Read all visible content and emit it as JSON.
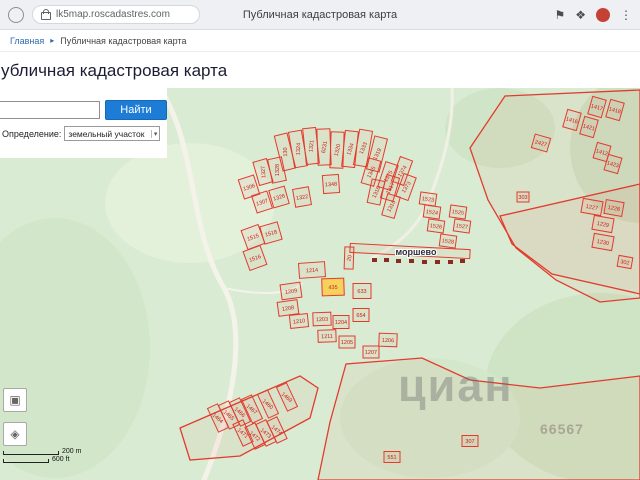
{
  "browser": {
    "url": "lk5map.roscadastres.com",
    "tab_title": "Публичная кадастровая карта"
  },
  "icons": {
    "bookmark": "⚑",
    "extensions": "❖",
    "menu": "⋮",
    "dropdown": "▾",
    "frame": "▣",
    "layers": "◈"
  },
  "breadcrumb": {
    "home": "Главная",
    "separator": "▸",
    "current": "Публичная кадастровая карта"
  },
  "page": {
    "title": "убличная кадастровая карта"
  },
  "search": {
    "button": "Найти",
    "filter_label": "Определение:",
    "filter_value": "земельный участок"
  },
  "map": {
    "place_label": "моршево",
    "watermark": {
      "brand": "циан",
      "number": "66567"
    },
    "scale": {
      "metric": "200 m",
      "imperial": "600 ft"
    },
    "colors": {
      "base": "#d9ecd3",
      "parcel_stroke": "#e23b2e",
      "parcel_fill": "rgba(240,70,50,0.06)",
      "label": "#c81e14",
      "building": "#8a2b20"
    },
    "terrain": [
      [
        600,
        300,
        115,
        95,
        "#cfe4c5"
      ],
      [
        640,
        60,
        70,
        75,
        "#cde2c3"
      ],
      [
        55,
        260,
        95,
        130,
        "#d2e7ca"
      ],
      [
        500,
        40,
        55,
        40,
        "#d0e5c7"
      ],
      [
        190,
        115,
        85,
        60,
        "#e3f0da"
      ],
      [
        430,
        330,
        90,
        60,
        "#d3e7cb"
      ]
    ],
    "roads": [
      [
        "M160,0 C198,60 188,140 224,200 C246,240 236,312 204,392",
        "#f4f3ea",
        5
      ],
      [
        "M452,0 C454,44 440,84 428,114 C418,140 396,158 372,170",
        "#f0f1e4",
        3
      ],
      [
        "M224,200 C262,208 288,206 302,196",
        "#f4f3ea",
        2
      ]
    ],
    "boundaries": [
      "470,60 505,8 640,2 640,210 600,214 556,192 516,160 488,112",
      "500,128 640,96 640,206 552,186 512,156",
      "330,334 346,276 422,270 470,292 540,300 640,288 640,392 318,392",
      "180,340 300,288 318,300 310,330 240,368 190,372"
    ],
    "parcels": [
      [
        "130",
        285,
        64,
        13,
        36,
        -14,
        -78
      ],
      [
        "1324",
        298,
        61,
        13,
        36,
        -10,
        -78
      ],
      [
        "1321",
        311,
        58,
        13,
        36,
        -6,
        -78
      ],
      [
        "6231",
        324,
        59,
        13,
        36,
        -2,
        -78
      ],
      [
        "1320",
        337,
        62,
        13,
        36,
        2,
        -78
      ],
      [
        "1334",
        350,
        61,
        13,
        36,
        6,
        -78
      ],
      [
        "1333",
        363,
        60,
        13,
        36,
        10,
        -78
      ],
      [
        "1319",
        377,
        66,
        13,
        34,
        14,
        -78
      ],
      [
        "1345",
        371,
        84,
        13,
        26,
        16,
        -78
      ],
      [
        "1375",
        388,
        88,
        13,
        26,
        18,
        -78
      ],
      [
        "1374",
        402,
        83,
        13,
        26,
        20,
        -78
      ],
      [
        "1373",
        406,
        99,
        13,
        24,
        20,
        -78
      ],
      [
        "1317",
        390,
        100,
        13,
        24,
        16,
        -78
      ],
      [
        "1318",
        376,
        104,
        13,
        24,
        12,
        -78
      ],
      [
        "1316",
        391,
        118,
        13,
        22,
        16,
        -78
      ],
      [
        "1306",
        249,
        99,
        16,
        20,
        -18,
        0
      ],
      [
        "1327",
        263,
        84,
        14,
        24,
        -16,
        -78
      ],
      [
        "1328",
        277,
        82,
        14,
        24,
        -12,
        -78
      ],
      [
        "1307",
        262,
        114,
        16,
        18,
        -18,
        0
      ],
      [
        "1326",
        279,
        109,
        16,
        18,
        -16,
        0
      ],
      [
        "1322",
        302,
        109,
        16,
        18,
        -10,
        0
      ],
      [
        "1348",
        331,
        96,
        16,
        18,
        -4,
        0
      ],
      [
        "1515",
        253,
        149,
        18,
        20,
        -20,
        0
      ],
      [
        "1518",
        271,
        145,
        18,
        18,
        -16,
        0
      ],
      [
        "1516",
        255,
        170,
        18,
        20,
        -20,
        0
      ],
      [
        "1214",
        312,
        182,
        26,
        15,
        -4,
        0
      ],
      [
        "20",
        349,
        170,
        9,
        22,
        2,
        -78
      ],
      [
        "435",
        333,
        199,
        22,
        17,
        -2,
        0,
        "#f6d15c"
      ],
      [
        "633",
        362,
        203,
        18,
        15,
        0,
        0
      ],
      [
        "1209",
        291,
        203,
        20,
        15,
        -8,
        0
      ],
      [
        "1208",
        288,
        220,
        20,
        14,
        -8,
        0
      ],
      [
        "1210",
        299,
        233,
        18,
        13,
        -6,
        0
      ],
      [
        "1203",
        322,
        231,
        18,
        13,
        -2,
        0
      ],
      [
        "1204",
        341,
        234,
        16,
        13,
        0,
        0
      ],
      [
        "654",
        361,
        227,
        16,
        13,
        0,
        0
      ],
      [
        "1211",
        327,
        248,
        18,
        12,
        -2,
        0
      ],
      [
        "1205",
        347,
        254,
        16,
        12,
        0,
        0
      ],
      [
        "1206",
        388,
        252,
        18,
        13,
        2,
        0
      ],
      [
        "1207",
        371,
        264,
        16,
        12,
        0,
        0
      ],
      [
        "1523",
        428,
        111,
        16,
        12,
        8,
        0
      ],
      [
        "1524",
        432,
        124,
        16,
        12,
        8,
        0
      ],
      [
        "1526",
        436,
        138,
        16,
        12,
        8,
        0
      ],
      [
        "1525",
        458,
        124,
        16,
        12,
        8,
        0
      ],
      [
        "1527",
        462,
        138,
        16,
        12,
        8,
        0
      ],
      [
        "1528",
        448,
        153,
        16,
        12,
        8,
        0
      ],
      [
        "1417",
        597,
        19,
        14,
        18,
        16,
        0
      ],
      [
        "1418",
        615,
        22,
        14,
        18,
        16,
        0
      ],
      [
        "1416",
        572,
        32,
        14,
        18,
        16,
        0
      ],
      [
        "1421",
        589,
        39,
        14,
        18,
        16,
        0
      ],
      [
        "2427",
        541,
        55,
        16,
        14,
        16,
        0
      ],
      [
        "1412",
        602,
        64,
        14,
        16,
        16,
        0
      ],
      [
        "1423",
        613,
        76,
        14,
        16,
        16,
        0
      ],
      [
        "1227",
        592,
        119,
        20,
        14,
        10,
        0
      ],
      [
        "1228",
        614,
        120,
        18,
        14,
        10,
        0
      ],
      [
        "1229",
        603,
        136,
        20,
        14,
        10,
        0
      ],
      [
        "1230",
        603,
        154,
        20,
        14,
        10,
        0
      ],
      [
        "303",
        523,
        109,
        12,
        10,
        0,
        0
      ],
      [
        "302",
        625,
        174,
        14,
        11,
        10,
        0
      ],
      [
        "1469",
        287,
        309,
        11,
        26,
        -25,
        65
      ],
      [
        "1460",
        268,
        316,
        11,
        26,
        -25,
        65
      ],
      [
        "1467",
        252,
        321,
        11,
        26,
        -25,
        65
      ],
      [
        "1466",
        240,
        324,
        11,
        26,
        -25,
        65
      ],
      [
        "1465",
        229,
        327,
        11,
        26,
        -25,
        65
      ],
      [
        "1464",
        218,
        330,
        11,
        26,
        -25,
        65
      ],
      [
        "1471",
        243,
        345,
        11,
        24,
        -25,
        65
      ],
      [
        "1472",
        255,
        348,
        11,
        24,
        -25,
        65
      ],
      [
        "1473",
        266,
        345,
        11,
        24,
        -25,
        65
      ],
      [
        "1474",
        277,
        342,
        11,
        24,
        -25,
        65
      ],
      [
        "551",
        392,
        369,
        16,
        11,
        0,
        0
      ],
      [
        "307",
        470,
        353,
        16,
        11,
        0,
        0
      ],
      [
        "",
        410,
        163,
        120,
        9,
        3,
        0
      ]
    ],
    "buildings": [
      [
        372,
        170
      ],
      [
        384,
        170
      ],
      [
        396,
        171
      ],
      [
        409,
        171
      ],
      [
        422,
        172
      ],
      [
        435,
        172
      ],
      [
        448,
        172
      ],
      [
        460,
        171
      ]
    ]
  }
}
